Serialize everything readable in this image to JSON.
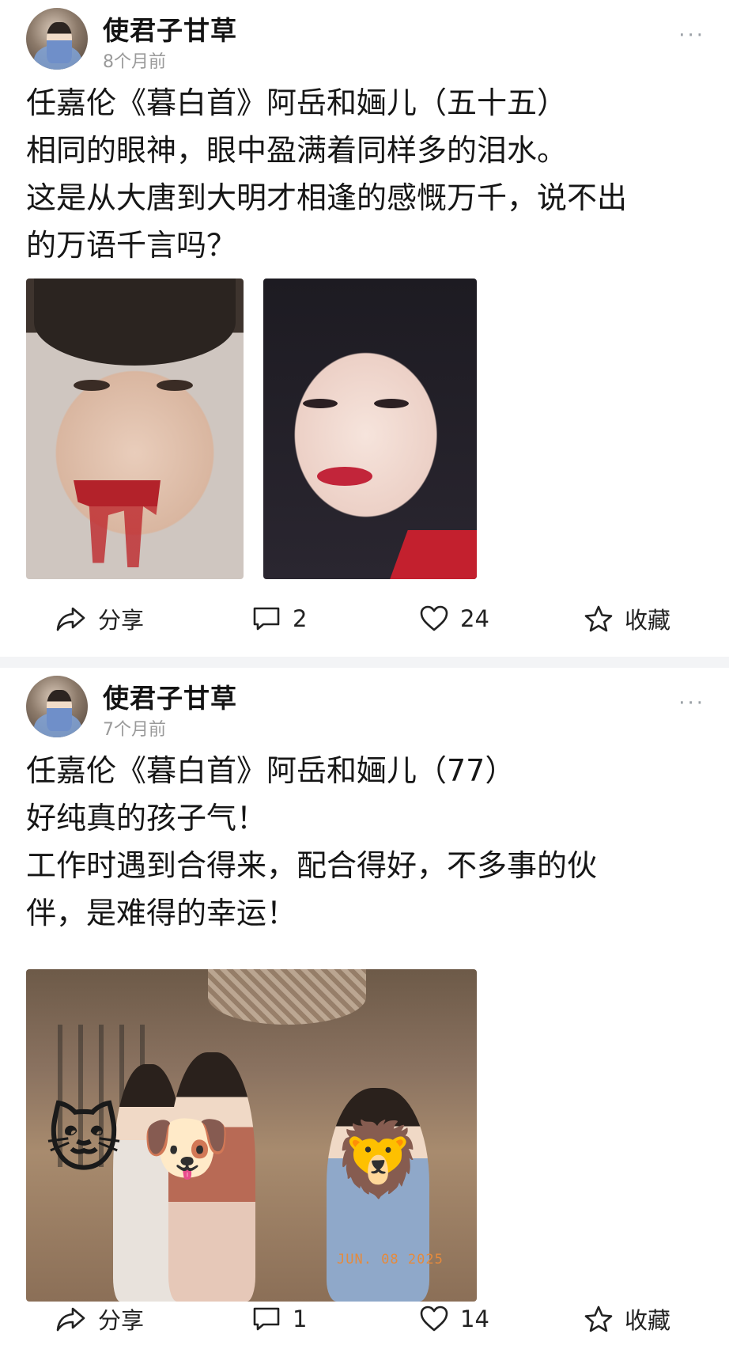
{
  "posts": [
    {
      "author": "使君子甘草",
      "time": "8个月前",
      "more": "···",
      "lines": [
        "任嘉伦《暮白首》阿岳和婳儿（五十五）",
        "相同的眼神，眼中盈满着同样多的泪水。",
        "这是从大唐到大明才相逢的感慨万千，说不出",
        "的万语千言吗？"
      ],
      "actions": {
        "share": "分享",
        "comments": "2",
        "likes": "24",
        "favorite": "收藏"
      }
    },
    {
      "author": "使君子甘草",
      "time": "7个月前",
      "more": "···",
      "lines": [
        "任嘉伦《暮白首》阿岳和婳儿（77）",
        "好纯真的孩子气！",
        "工作时遇到合得来，配合得好，不多事的伙",
        "伴，是难得的幸运！"
      ],
      "photo_stamp": "JUN. 08 2025",
      "emojis": [
        "🐱",
        "🐶",
        "🦁"
      ],
      "actions": {
        "share": "分享",
        "comments": "1",
        "likes": "14",
        "favorite": "收藏"
      }
    }
  ],
  "icons": [
    "share-icon",
    "comment-icon",
    "heart-icon",
    "star-icon",
    "more-icon"
  ],
  "colors": {
    "separator": "#f3f4f6",
    "time_text": "#9a9a9a",
    "body_text": "#161616"
  }
}
